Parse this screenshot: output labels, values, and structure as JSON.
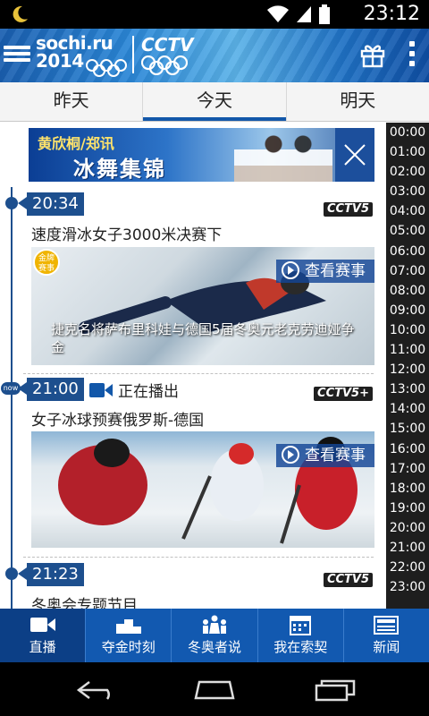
{
  "status_bar": {
    "time": "23:12",
    "icons": [
      "moon-icon",
      "wifi-icon",
      "signal-icon",
      "battery-icon"
    ]
  },
  "header": {
    "logo_line1": "sochi.ru",
    "logo_line2": "2014",
    "broadcaster": "CCTV",
    "icons": [
      "menu-icon",
      "gift-icon",
      "more-icon"
    ]
  },
  "tabs": [
    {
      "label": "昨天",
      "active": false
    },
    {
      "label": "今天",
      "active": true
    },
    {
      "label": "明天",
      "active": false
    }
  ],
  "banner": {
    "line1": "黄欣桐/郑讯",
    "line2": "冰舞集锦",
    "close_icon": "close-icon"
  },
  "schedule": [
    {
      "time": "20:34",
      "channel": "CCTV5",
      "title": "速度滑冰女子3000米决赛下",
      "view_label": "查看赛事",
      "medal_label": "金牌赛事",
      "caption": "捷克名将萨布里科娃与德国5届冬奥元老克劳迪娅争金"
    },
    {
      "time": "21:00",
      "now_badge": "now",
      "live_label": "正在播出",
      "channel": "CCTV5+",
      "title": "女子冰球预赛俄罗斯-德国",
      "view_label": "查看赛事"
    },
    {
      "time": "21:23",
      "channel": "CCTV5",
      "title": "冬奥会专题节目"
    }
  ],
  "hours": [
    "00:00",
    "01:00",
    "02:00",
    "03:00",
    "04:00",
    "05:00",
    "06:00",
    "07:00",
    "08:00",
    "09:00",
    "10:00",
    "11:00",
    "12:00",
    "13:00",
    "14:00",
    "15:00",
    "16:00",
    "17:00",
    "18:00",
    "19:00",
    "20:00",
    "21:00",
    "22:00",
    "23:00"
  ],
  "bottom_nav": [
    {
      "label": "直播",
      "icon": "video-camera-icon",
      "active": true
    },
    {
      "label": "夺金时刻",
      "icon": "podium-icon",
      "active": false
    },
    {
      "label": "冬奥者说",
      "icon": "people-icon",
      "active": false
    },
    {
      "label": "我在索契",
      "icon": "calendar-icon",
      "active": false
    },
    {
      "label": "新闻",
      "icon": "news-icon",
      "active": false
    }
  ],
  "colors": {
    "primary": "#1259b0",
    "timeline": "#1d4f8e",
    "hours_bg": "#1e1e1e"
  }
}
